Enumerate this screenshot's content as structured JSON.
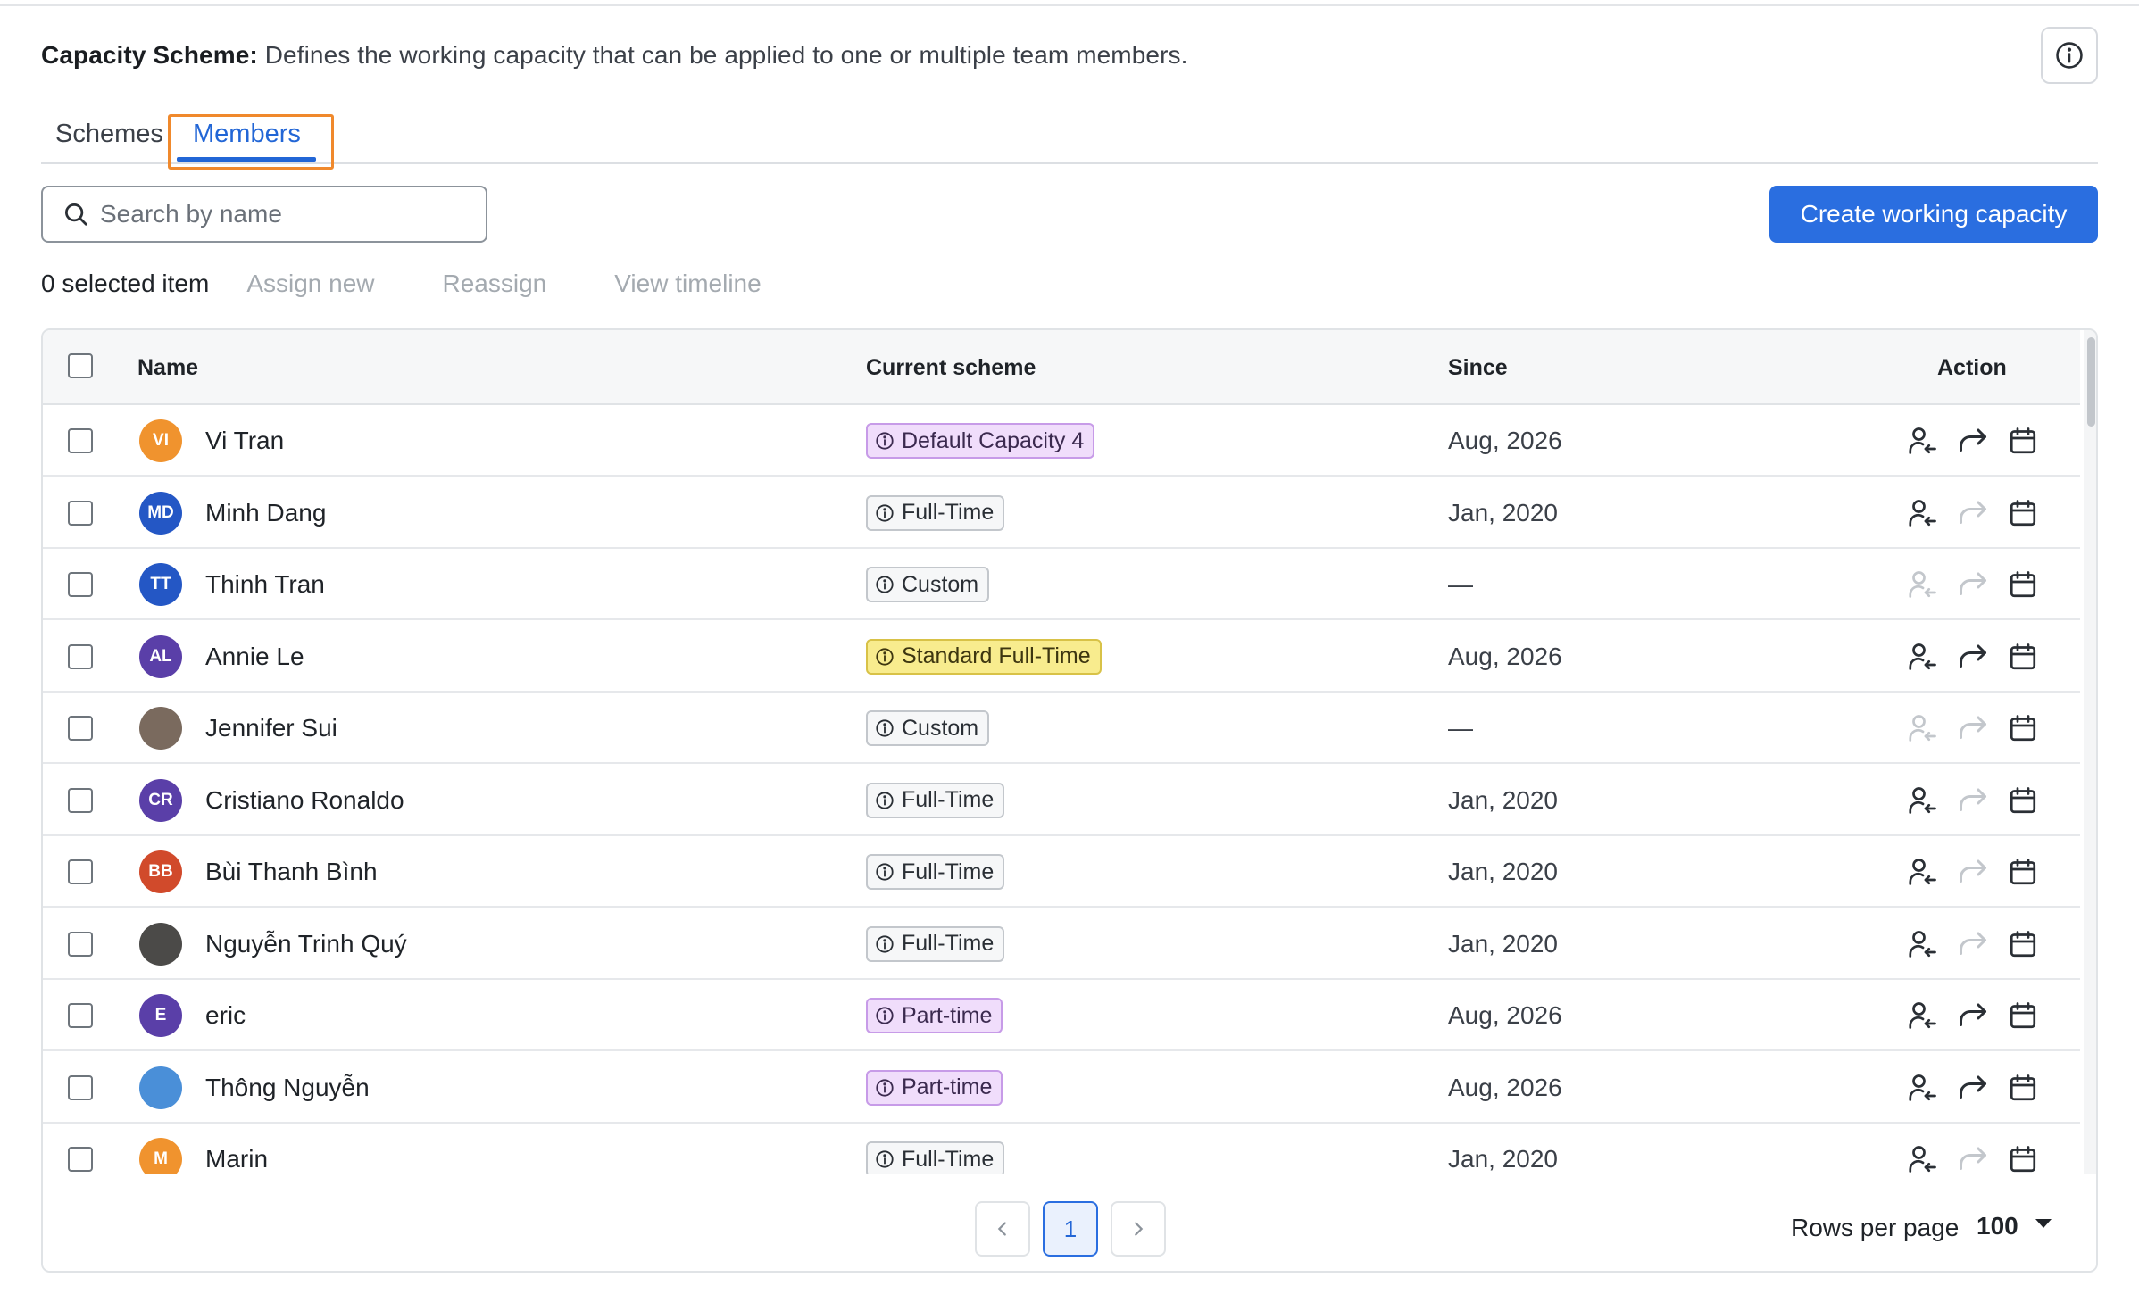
{
  "header": {
    "title": "Capacity Scheme:",
    "description": "Defines the working capacity that can be applied to one or multiple team members."
  },
  "tabs": [
    {
      "label": "Schemes",
      "active": false
    },
    {
      "label": "Members",
      "active": true
    }
  ],
  "search": {
    "placeholder": "Search by name",
    "value": ""
  },
  "create_button": "Create working capacity",
  "selection": {
    "count_label": "0 selected item",
    "actions": [
      "Assign new",
      "Reassign",
      "View timeline"
    ]
  },
  "table": {
    "columns": [
      "Name",
      "Current scheme",
      "Since",
      "Action"
    ],
    "rows": [
      {
        "initials": "VI",
        "avatar_color": "#f0932e",
        "name": "Vi Tran",
        "scheme": "Default Capacity 4",
        "scheme_style": "purple",
        "since": "Aug, 2026",
        "assign_enabled": true,
        "reassign_enabled": true
      },
      {
        "initials": "MD",
        "avatar_color": "#2457c5",
        "name": "Minh Dang",
        "scheme": "Full-Time",
        "scheme_style": "gray",
        "since": "Jan, 2020",
        "assign_enabled": true,
        "reassign_enabled": false
      },
      {
        "initials": "TT",
        "avatar_color": "#2457c5",
        "name": "Thinh Tran",
        "scheme": "Custom",
        "scheme_style": "gray",
        "since": "—",
        "assign_enabled": false,
        "reassign_enabled": false
      },
      {
        "initials": "AL",
        "avatar_color": "#5a3fa8",
        "name": "Annie Le",
        "scheme": "Standard Full-Time",
        "scheme_style": "yellow",
        "since": "Aug, 2026",
        "assign_enabled": true,
        "reassign_enabled": true
      },
      {
        "initials": "",
        "avatar_color": "#7a6a5e",
        "name": "Jennifer Sui",
        "scheme": "Custom",
        "scheme_style": "gray",
        "since": "—",
        "assign_enabled": false,
        "reassign_enabled": false
      },
      {
        "initials": "CR",
        "avatar_color": "#5a3fa8",
        "name": "Cristiano Ronaldo",
        "scheme": "Full-Time",
        "scheme_style": "gray",
        "since": "Jan, 2020",
        "assign_enabled": true,
        "reassign_enabled": false
      },
      {
        "initials": "BB",
        "avatar_color": "#d14a2b",
        "name": "Bùi Thanh Bình",
        "scheme": "Full-Time",
        "scheme_style": "gray",
        "since": "Jan, 2020",
        "assign_enabled": true,
        "reassign_enabled": false
      },
      {
        "initials": "",
        "avatar_color": "#4b4a48",
        "name": "Nguyễn Trinh Quý",
        "scheme": "Full-Time",
        "scheme_style": "gray",
        "since": "Jan, 2020",
        "assign_enabled": true,
        "reassign_enabled": false
      },
      {
        "initials": "E",
        "avatar_color": "#5a3fa8",
        "name": "eric",
        "scheme": "Part-time",
        "scheme_style": "purple",
        "since": "Aug, 2026",
        "assign_enabled": true,
        "reassign_enabled": true
      },
      {
        "initials": "",
        "avatar_color": "#4a8fd8",
        "name": "Thông Nguyễn",
        "scheme": "Part-time",
        "scheme_style": "purple",
        "since": "Aug, 2026",
        "assign_enabled": true,
        "reassign_enabled": true
      },
      {
        "initials": "M",
        "avatar_color": "#f0932e",
        "name": "Marin",
        "scheme": "Full-Time",
        "scheme_style": "gray",
        "since": "Jan, 2020",
        "assign_enabled": true,
        "reassign_enabled": false
      }
    ]
  },
  "pagination": {
    "current_page": "1",
    "rows_per_page_label": "Rows per page",
    "rows_per_page_value": "100"
  },
  "colors": {
    "accent": "#2a6ee0",
    "highlight": "#f0892c"
  }
}
